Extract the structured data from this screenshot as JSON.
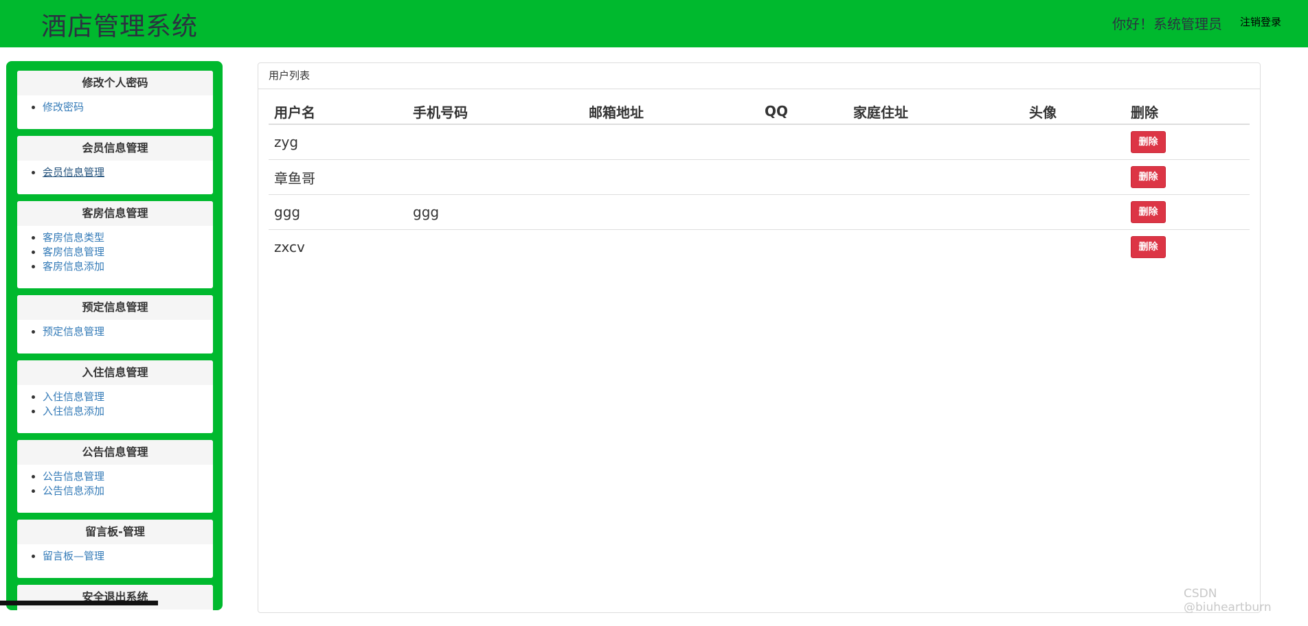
{
  "header": {
    "app_title": "酒店管理系统",
    "greeting": "你好！系统管理员",
    "logout_label": "注销登录",
    "bg_color": "#00b92e"
  },
  "sidebar": {
    "panels": [
      {
        "title": "修改个人密码",
        "items": [
          {
            "label": "修改密码"
          }
        ]
      },
      {
        "title": "会员信息管理",
        "items": [
          {
            "label": "会员信息管理",
            "active": true
          }
        ]
      },
      {
        "title": "客房信息管理",
        "items": [
          {
            "label": "客房信息类型"
          },
          {
            "label": "客房信息管理"
          },
          {
            "label": "客房信息添加"
          }
        ]
      },
      {
        "title": "预定信息管理",
        "items": [
          {
            "label": "预定信息管理"
          }
        ]
      },
      {
        "title": "入住信息管理",
        "items": [
          {
            "label": "入住信息管理"
          },
          {
            "label": "入住信息添加"
          }
        ]
      },
      {
        "title": "公告信息管理",
        "items": [
          {
            "label": "公告信息管理"
          },
          {
            "label": "公告信息添加"
          }
        ]
      },
      {
        "title": "留言板-管理",
        "items": [
          {
            "label": "留言板—管理"
          }
        ]
      },
      {
        "title": "安全退出系统",
        "items": []
      }
    ]
  },
  "main": {
    "panel_title": "用户列表",
    "table": {
      "headers": [
        "用户名",
        "手机号码",
        "邮箱地址",
        "QQ",
        "家庭住址",
        "头像",
        "删除"
      ],
      "rows": [
        {
          "username": "zyg",
          "phone": "",
          "email": "",
          "qq": "",
          "address": "",
          "avatar": "",
          "action": "删除"
        },
        {
          "username": "章鱼哥",
          "phone": "",
          "email": "",
          "qq": "",
          "address": "",
          "avatar": "",
          "action": "删除"
        },
        {
          "username": "ggg",
          "phone": "ggg",
          "email": "",
          "qq": "",
          "address": "",
          "avatar": "",
          "action": "删除"
        },
        {
          "username": "zxcv",
          "phone": "",
          "email": "",
          "qq": "",
          "address": "",
          "avatar": "",
          "action": "删除"
        }
      ]
    },
    "delete_color": "#dc3545"
  },
  "watermark": "CSDN @biuheartburn"
}
